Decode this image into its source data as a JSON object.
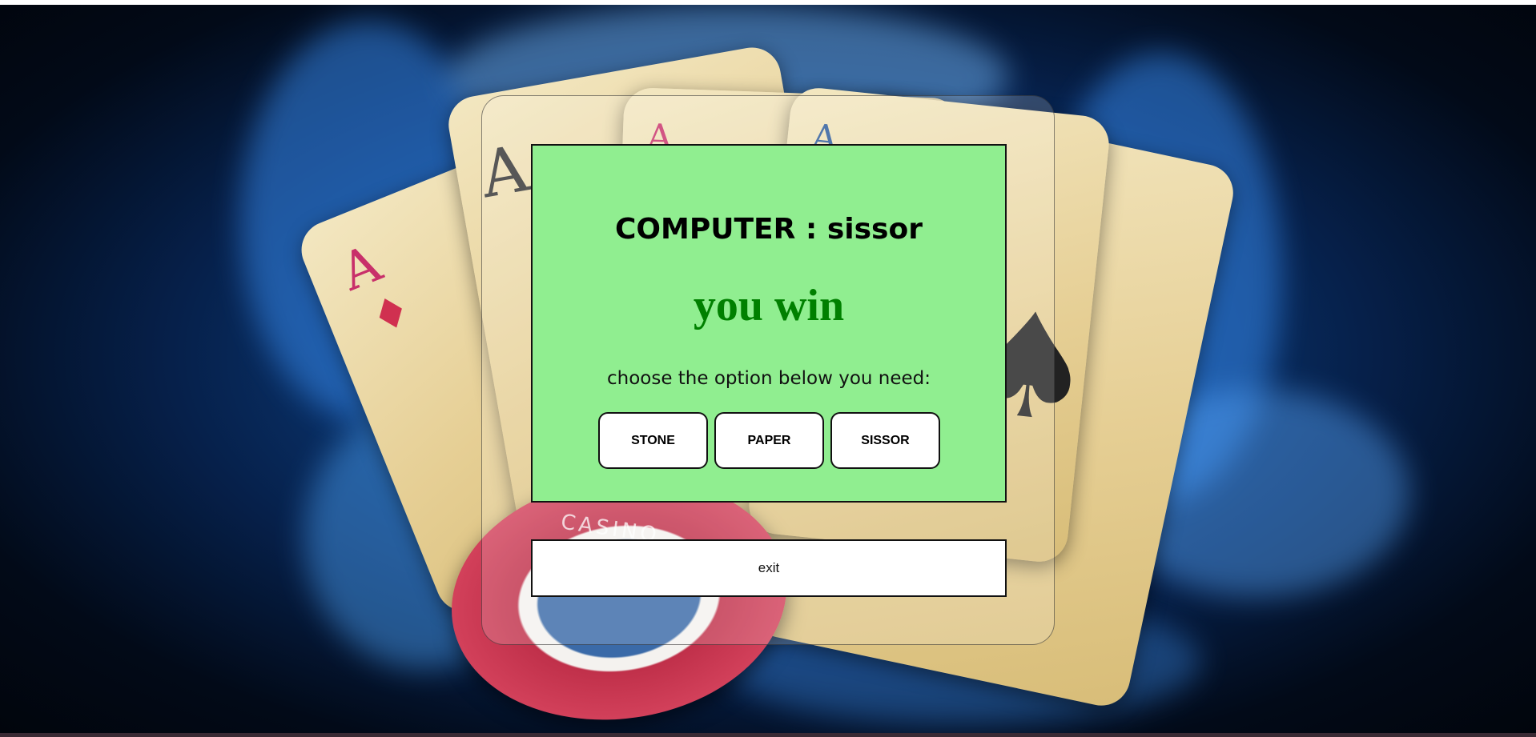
{
  "game": {
    "computer_label": "COMPUTER",
    "separator": ":",
    "computer_choice": "sissor",
    "result": "you win",
    "prompt": "choose the option below you need:",
    "options": [
      "STONE",
      "PAPER",
      "SISSOR"
    ],
    "exit_label": "exit"
  },
  "background": {
    "chip_text": "CASINO",
    "card_letters": [
      "A",
      "A",
      "A",
      "A"
    ]
  },
  "colors": {
    "game_box_bg": "#90ee90",
    "result_text": "#008000",
    "background_flame": "#1a5fb0"
  }
}
